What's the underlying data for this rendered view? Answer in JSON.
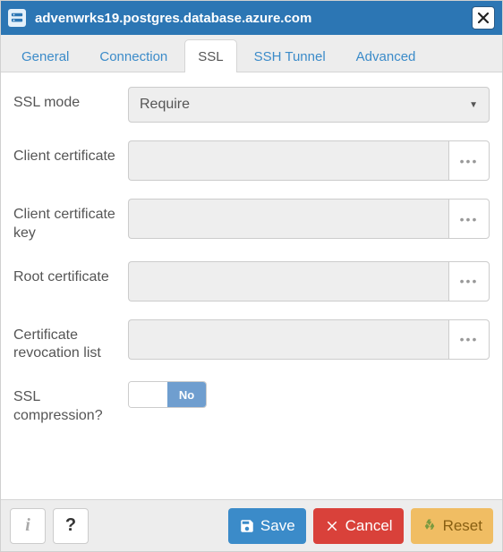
{
  "window": {
    "title": "advenwrks19.postgres.database.azure.com"
  },
  "tabs": {
    "general": "General",
    "connection": "Connection",
    "ssl": "SSL",
    "ssh": "SSH Tunnel",
    "advanced": "Advanced",
    "active": "ssl"
  },
  "form": {
    "ssl_mode": {
      "label": "SSL mode",
      "value": "Require"
    },
    "client_cert": {
      "label": "Client certificate",
      "value": ""
    },
    "client_cert_key": {
      "label": "Client certificate key",
      "value": ""
    },
    "root_cert": {
      "label": "Root certificate",
      "value": ""
    },
    "crl": {
      "label": "Certificate revocation list",
      "value": ""
    },
    "ssl_compression": {
      "label": "SSL compression?",
      "value_label": "No",
      "value": false
    }
  },
  "footer": {
    "save": "Save",
    "cancel": "Cancel",
    "reset": "Reset"
  }
}
